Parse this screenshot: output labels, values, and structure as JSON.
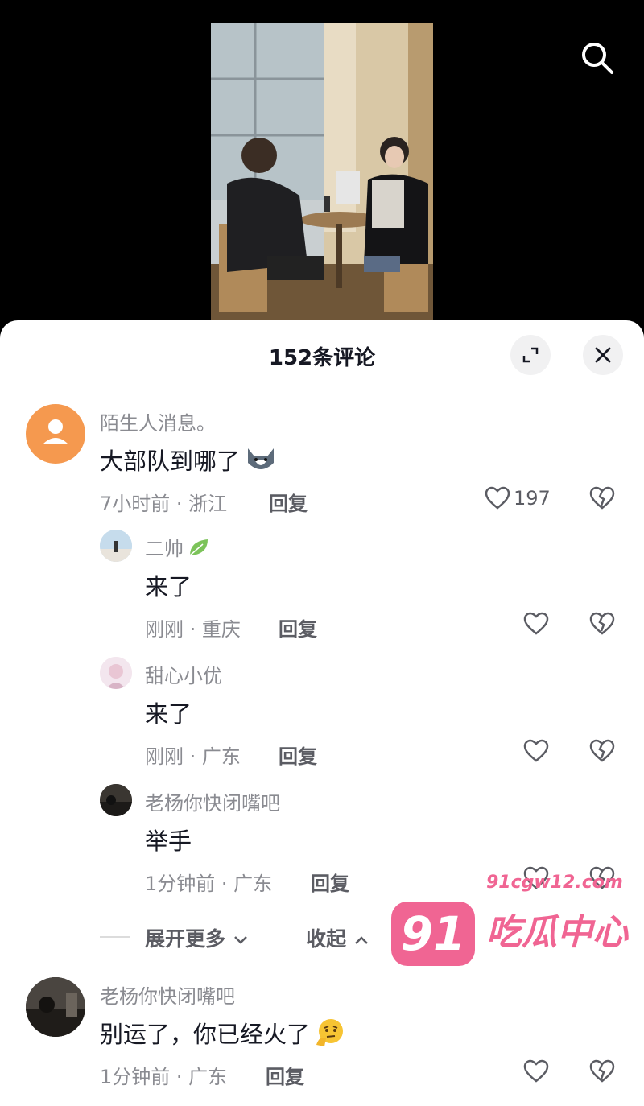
{
  "header": {
    "comment_count_title": "152条评论"
  },
  "icons": {
    "search": "search-icon",
    "expand": "expand-icon",
    "close": "close-icon",
    "like": "heart-outline-icon",
    "dislike": "broken-heart-icon"
  },
  "comments": [
    {
      "name": "陌生人消息。",
      "text": "大部队到哪了",
      "time_location": "7小时前 · 浙江",
      "reply": "回复",
      "likes": "197",
      "emoji": "husky-emoji"
    },
    {
      "name": "二帅",
      "text": "来了",
      "time_location": "刚刚 · 重庆",
      "reply": "回复"
    },
    {
      "name": "甜心小优",
      "text": "来了",
      "time_location": "刚刚 · 广东",
      "reply": "回复"
    },
    {
      "name": "老杨你快闭嘴吧",
      "text": "举手",
      "time_location": "1分钟前 · 广东",
      "reply": "回复"
    },
    {
      "name": "老杨你快闭嘴吧",
      "text": "别运了，你已经火了",
      "time_location": "1分钟前 · 广东",
      "reply": "回复",
      "emoji": "thinking-face-emoji"
    }
  ],
  "thread_controls": {
    "expand_more": "展开更多",
    "collapse": "收起"
  },
  "watermark": {
    "badge": "91",
    "url": "91cgw12.com",
    "name": "吃瓜中心"
  },
  "colors": {
    "accent": "#f06593",
    "avatar_default": "#f5994f",
    "text_primary": "#161823",
    "text_secondary": "#8a8b91"
  }
}
